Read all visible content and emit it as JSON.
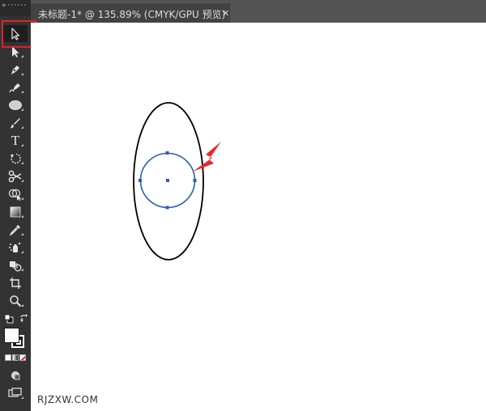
{
  "document_tab": {
    "title": "未标题-1* @ 135.89% (CMYK/GPU 预览)",
    "close_symbol": "✕"
  },
  "toolbar": {
    "collapse_symbol": "»",
    "tools": [
      {
        "name": "selection-tool",
        "icon": "arrow-outline-icon",
        "active": true
      },
      {
        "name": "direct-selection-tool",
        "icon": "arrow-filled-icon"
      },
      {
        "name": "pen-tool",
        "icon": "pen-icon"
      },
      {
        "name": "curvature-tool",
        "icon": "curvature-pen-icon"
      },
      {
        "name": "ellipse-tool",
        "icon": "ellipse-icon"
      },
      {
        "name": "paintbrush-tool",
        "icon": "brush-icon"
      },
      {
        "name": "type-tool",
        "icon": "type-icon",
        "glyph": "T"
      },
      {
        "name": "rotate-tool",
        "icon": "rotate-icon"
      },
      {
        "name": "scissors-tool",
        "icon": "scissors-icon"
      },
      {
        "name": "shape-builder-tool",
        "icon": "shape-builder-icon"
      },
      {
        "name": "gradient-tool",
        "icon": "gradient-icon"
      },
      {
        "name": "eyedropper-tool",
        "icon": "eyedropper-icon"
      },
      {
        "name": "symbol-sprayer-tool",
        "icon": "symbol-sprayer-icon"
      },
      {
        "name": "blend-tool",
        "icon": "blend-icon"
      },
      {
        "name": "artboard-tool",
        "icon": "artboard-icon"
      },
      {
        "name": "zoom-tool",
        "icon": "zoom-icon"
      },
      {
        "name": "default-colors",
        "icon": "default-colors-icon"
      },
      {
        "name": "fill-stroke-swatch",
        "icon": "fill-stroke-icon"
      },
      {
        "name": "color-modes",
        "icon": "color-mode-icon"
      },
      {
        "name": "drawing-mode",
        "icon": "draw-mode-icon"
      },
      {
        "name": "screen-mode",
        "icon": "screen-mode-icon"
      }
    ]
  },
  "canvas": {
    "background": "#ffffff",
    "outer_ellipse_stroke": "#000000",
    "selected_circle_stroke": "#2e5bb8",
    "arrow_color": "#e8262a",
    "highlight_color": "#e02424"
  },
  "watermark": "RJZXW.COM"
}
